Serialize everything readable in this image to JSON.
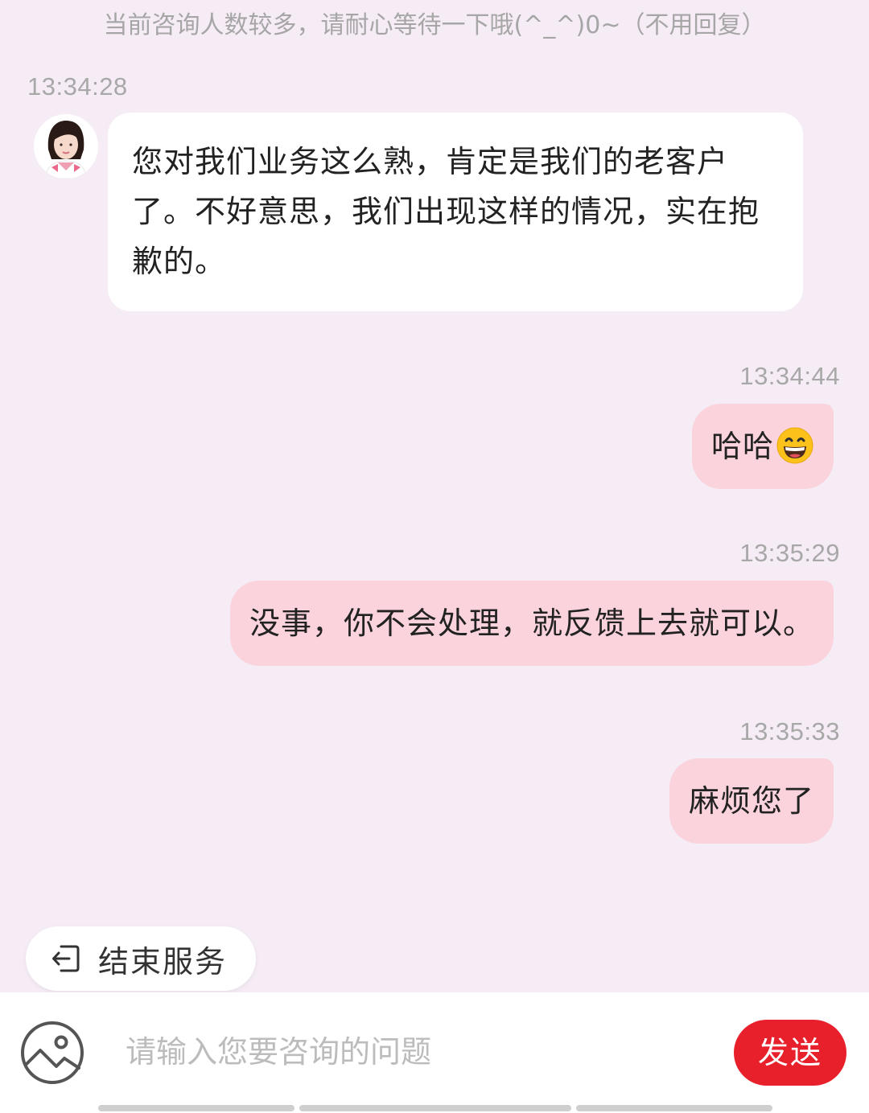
{
  "system_notice": "当前咨询人数较多，请耐心等待一下哦(^_^)0~（不用回复）",
  "messages": [
    {
      "sender": "agent",
      "time": "13:34:28",
      "text": "您对我们业务这么熟，肯定是我们的老客户了。不好意思，我们出现这样的情况，实在抱歉的。"
    },
    {
      "sender": "user",
      "time": "13:34:44",
      "text": "哈哈",
      "emoji": "grinning-face-emoji"
    },
    {
      "sender": "user",
      "time": "13:35:29",
      "text": "没事，你不会处理，就反馈上去就可以。"
    },
    {
      "sender": "user",
      "time": "13:35:33",
      "text": "麻烦您了"
    }
  ],
  "end_service": {
    "icon": "exit-icon",
    "label": "结束服务"
  },
  "input": {
    "image_icon": "image-icon",
    "placeholder": "请输入您要咨询的问题",
    "value": "",
    "send_label": "发送"
  },
  "colors": {
    "background": "#f6ecf5",
    "user_bubble": "#fad3dc",
    "agent_bubble": "#ffffff",
    "send_button": "#e8202b"
  }
}
